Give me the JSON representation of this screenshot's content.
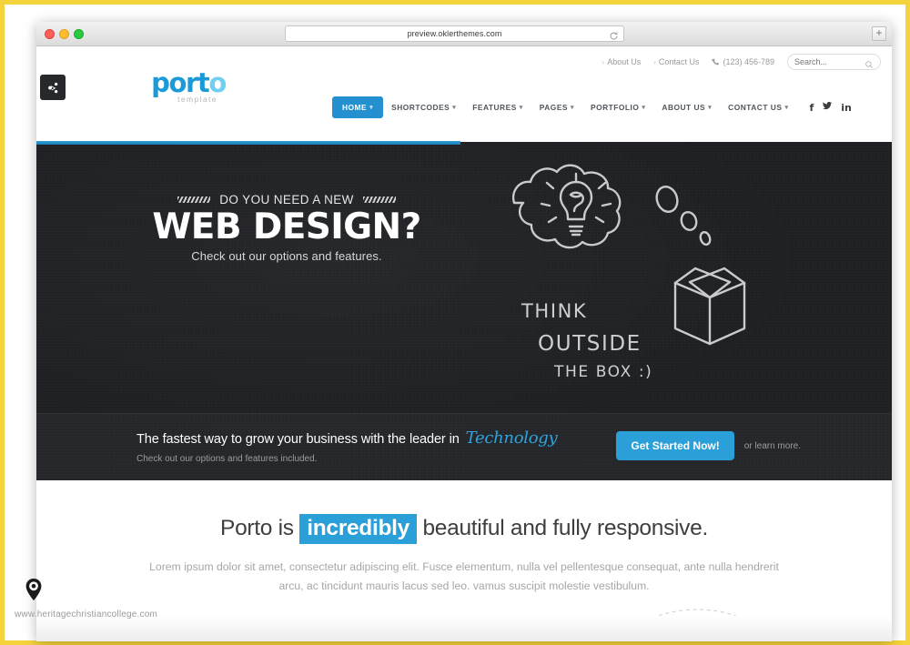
{
  "browser": {
    "url": "preview.oklerthemes.com",
    "reload_icon": "reload-icon",
    "new_tab_label": "+",
    "traffic_lights": [
      "close",
      "minimize",
      "zoom"
    ]
  },
  "share_badge": {
    "icon": "share-nodes-icon"
  },
  "topbar": {
    "links": [
      {
        "label": "About Us"
      },
      {
        "label": "Contact Us"
      }
    ],
    "phone": "(123) 456-789",
    "phone_icon": "phone-icon",
    "search": {
      "placeholder": "Search...",
      "value": "",
      "icon": "search-icon"
    }
  },
  "logo": {
    "word": "port",
    "word_tail": "o",
    "subtitle": "template"
  },
  "nav": {
    "items": [
      {
        "label": "HOME",
        "caret": "▾",
        "active": true
      },
      {
        "label": "SHORTCODES",
        "caret": "▾",
        "active": false
      },
      {
        "label": "FEATURES",
        "caret": "▾",
        "active": false
      },
      {
        "label": "PAGES",
        "caret": "▾",
        "active": false
      },
      {
        "label": "PORTFOLIO",
        "caret": "▾",
        "active": false
      },
      {
        "label": "ABOUT US",
        "caret": "▾",
        "active": false
      },
      {
        "label": "CONTACT US",
        "caret": "▾",
        "active": false
      }
    ],
    "social": [
      {
        "name": "facebook-icon",
        "glyph": "f"
      },
      {
        "name": "twitter-icon",
        "glyph": "🐦"
      },
      {
        "name": "linkedin-icon",
        "glyph": "in"
      }
    ]
  },
  "hero": {
    "eyebrow": "DO YOU NEED A NEW",
    "headline": "WEB DESIGN?",
    "subhead": "Check out our options and features.",
    "chalk_text_1": "THINK",
    "chalk_text_2": "OUTSIDE",
    "chalk_text_3": "THE BOX :)",
    "background_color": "#1d1f22"
  },
  "cta": {
    "line1_prefix": "The fastest way to grow your business with the leader in",
    "line1_script": "Technology",
    "line2": "Check out our options and features included.",
    "button_label": "Get Started Now!",
    "secondary_label": "or learn more.",
    "accent_color": "#2a9fd8"
  },
  "section": {
    "claim_prefix": "Porto is",
    "claim_highlight": "incredibly",
    "claim_suffix": "beautiful and fully responsive.",
    "lead": "Lorem ipsum dolor sit amet, consectetur adipiscing elit. Fusce elementum, nulla vel pellentesque consequat, ante nulla hendrerit arcu, ac tincidunt mauris lacus sed leo. vamus suscipit molestie vestibulum."
  },
  "watermark": {
    "text": "www.heritagechristiancollege.com",
    "pin_icon": "map-pin-icon"
  },
  "colors": {
    "accent": "#2a9fd8",
    "nav_active": "#2490d0",
    "logo": "#1a9bd7",
    "frame": "#f5d33c",
    "hero_bg": "#1d1f22"
  }
}
